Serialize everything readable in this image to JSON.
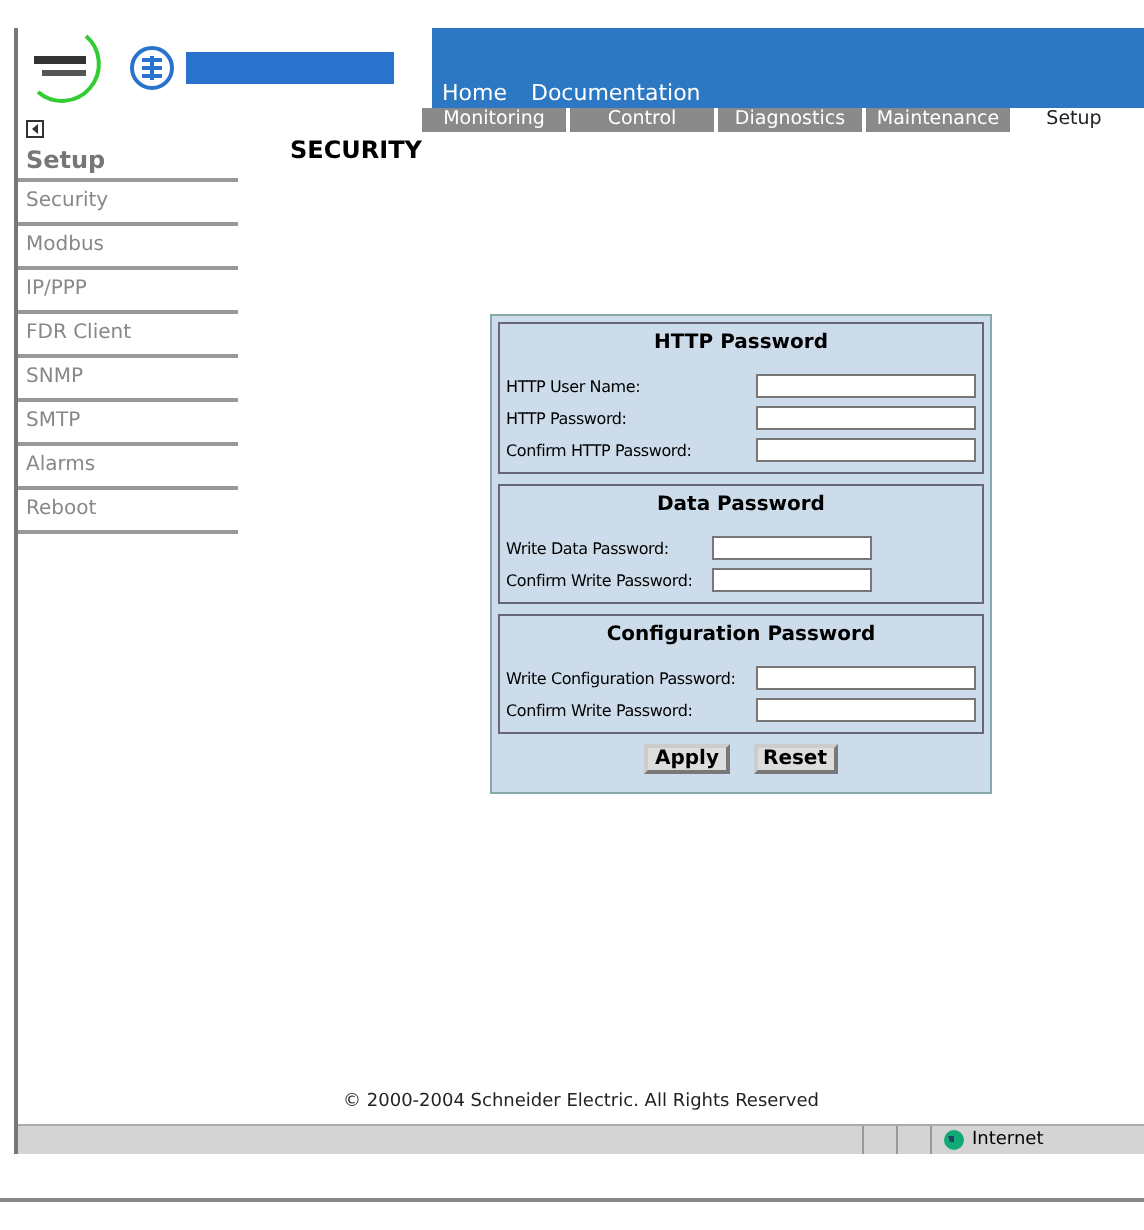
{
  "header": {
    "links": [
      "Home",
      "Documentation"
    ]
  },
  "tabs": [
    {
      "label": "Monitoring",
      "selected": false
    },
    {
      "label": "Control",
      "selected": false
    },
    {
      "label": "Diagnostics",
      "selected": false
    },
    {
      "label": "Maintenance",
      "selected": false
    },
    {
      "label": "Setup",
      "selected": true
    }
  ],
  "sidebar": {
    "title": "Setup",
    "items": [
      "Security",
      "Modbus",
      "IP/PPP",
      "FDR Client",
      "SNMP",
      "SMTP",
      "Alarms",
      "Reboot"
    ]
  },
  "page_title": "SECURITY",
  "sections": [
    {
      "title": "HTTP Password",
      "wide": true,
      "fields": [
        "HTTP User Name:",
        "HTTP Password:",
        "Confirm HTTP Password:"
      ]
    },
    {
      "title": "Data Password",
      "wide": false,
      "fields": [
        "Write Data Password:",
        "Confirm Write Password:"
      ]
    },
    {
      "title": "Configuration Password",
      "wide": true,
      "fields": [
        "Write Configuration Password:",
        "Confirm Write Password:"
      ]
    }
  ],
  "buttons": [
    "Apply",
    "Reset"
  ],
  "footer": "© 2000-2004 Schneider Electric. All Rights Reserved",
  "status_bar": {
    "zone": "Internet"
  }
}
